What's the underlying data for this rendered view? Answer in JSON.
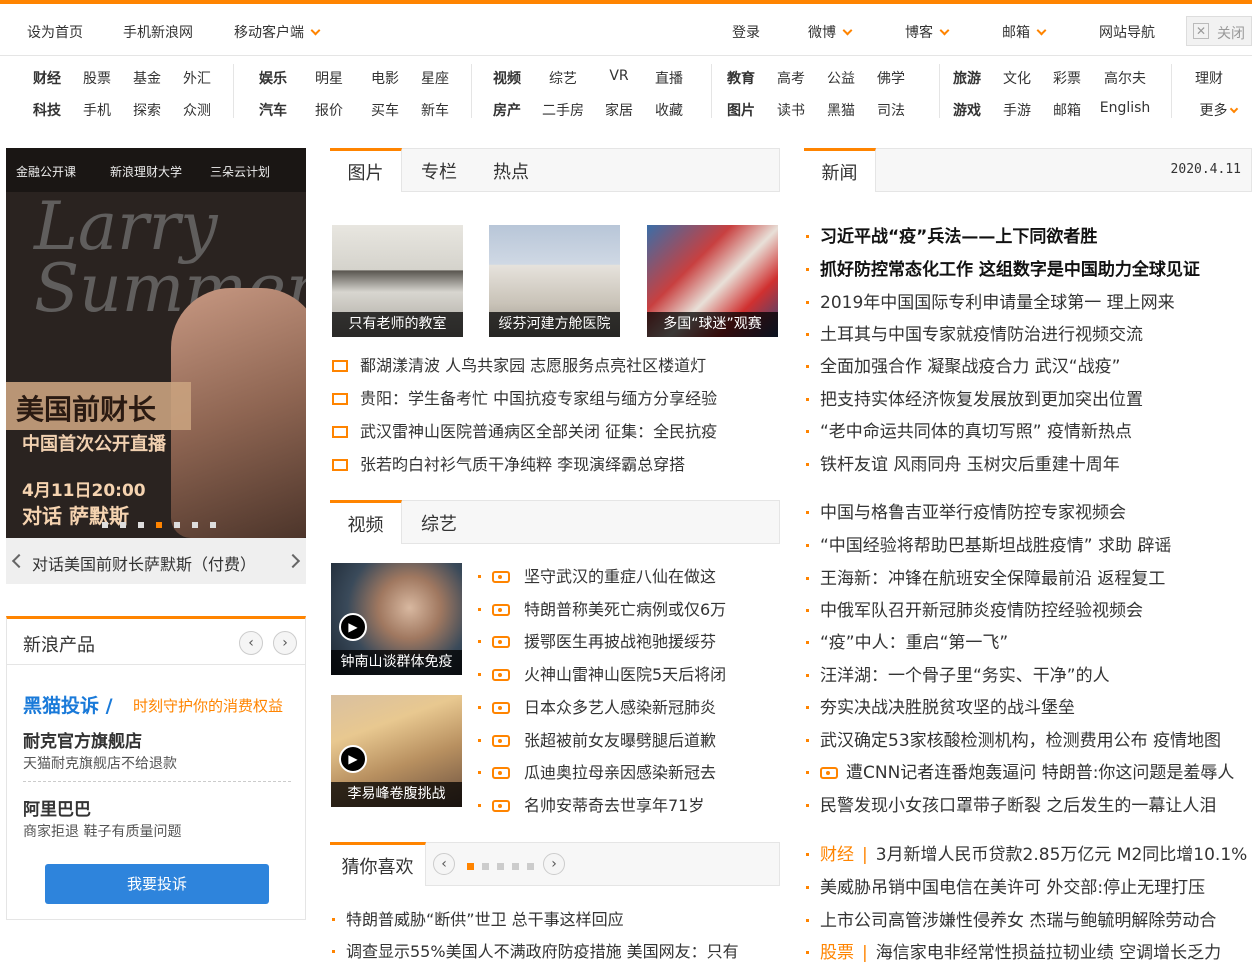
{
  "topbar": {
    "home": "设为首页",
    "mobile": "手机新浪网",
    "client": "移动客户端",
    "login": "登录",
    "weibo": "微博",
    "blog": "博客",
    "mail": "邮箱",
    "sitenav": "网站导航",
    "close": "关闭"
  },
  "nav": {
    "g1": [
      "财经",
      "股票",
      "基金",
      "外汇",
      "科技",
      "手机",
      "探索",
      "众测"
    ],
    "g2": [
      "娱乐",
      "明星",
      "电影",
      "星座",
      "汽车",
      "报价",
      "买车",
      "新车"
    ],
    "g3": [
      "视频",
      "综艺",
      "VR",
      "直播",
      "房产",
      "二手房",
      "家居",
      "收藏"
    ],
    "g4": [
      "教育",
      "高考",
      "公益",
      "佛学",
      "图片",
      "读书",
      "黑猫",
      "司法"
    ],
    "g5": [
      "旅游",
      "文化",
      "彩票",
      "高尔夫",
      "游戏",
      "手游",
      "邮箱",
      "English"
    ],
    "g6": [
      "理财",
      "更多"
    ]
  },
  "banner": {
    "logo1": "金融公开课",
    "logo2": "新浪理财大学",
    "logo3": "三朵云计划",
    "larry": "Larry",
    "summers": "Summers",
    "title1": "美国前财长",
    "title2": "中国首次公开直播",
    "date": "4月11日20:00",
    "dialog": "对话 萨默斯",
    "caption": "对话美国前财长萨默斯（付费）"
  },
  "products": {
    "title": "新浪产品",
    "heimao": "黑猫投诉",
    "slogan": "时刻守护你的消费权益",
    "items": [
      {
        "name": "耐克官方旗舰店",
        "desc": "天猫耐克旗舰店不给退款"
      },
      {
        "name": "阿里巴巴",
        "desc": "商家拒退 鞋子有质量问题"
      }
    ],
    "button": "我要投诉"
  },
  "pic": {
    "tabs": [
      "图片",
      "专栏",
      "热点"
    ],
    "thumbs": [
      "只有老师的教室",
      "绥芬河建方舱医院",
      "多国“球迷”观赛"
    ],
    "lines": [
      "鄱湖漾清波 人鸟共家园 志愿服务点亮社区楼道灯",
      "贵阳：学生备考忙 中国抗疫专家组与缅方分享经验",
      "武汉雷神山医院普通病区全部关闭 征集：全民抗疫",
      "张若昀白衬衫气质干净纯粹 李现演绎霸总穿搭"
    ]
  },
  "video": {
    "tabs": [
      "视频",
      "综艺"
    ],
    "thumbs": [
      "钟南山谈群体免疫",
      "李易峰卷腹挑战"
    ],
    "lines": [
      "坚守武汉的重症八仙在做这",
      "特朗普称美死亡病例或仅6万",
      "援鄂医生再披战袍驰援绥芬",
      "火神山雷神山医院5天后将闭",
      "日本众多艺人感染新冠肺炎",
      "张超被前女友曝劈腿后道歉",
      "瓜迪奥拉母亲因感染新冠去",
      "名帅安蒂奇去世享年71岁"
    ]
  },
  "guess": {
    "title": "猜你喜欢",
    "lines": [
      "特朗普威胁“断供”世卫 总干事这样回应",
      "调查显示55%美国人不满政府防疫措施 美国网友：只有"
    ]
  },
  "news": {
    "title": "新闻",
    "date": "2020.4.11",
    "lines": [
      {
        "t": "习近平战“疫”兵法——上下同欲者胜",
        "b": true
      },
      {
        "t": "抓好防控常态化工作 这组数字是中国助力全球见证",
        "b": true
      },
      {
        "t": "2019年中国国际专利申请量全球第一 理上网来"
      },
      {
        "t": "土耳其与中国专家就疫情防治进行视频交流"
      },
      {
        "t": "全面加强合作 凝聚战疫合力 武汉“战疫”"
      },
      {
        "t": "把支持实体经济恢复发展放到更加突出位置"
      },
      {
        "t": "“老中命运共同体的真切写照” 疫情新热点"
      },
      {
        "t": "铁杆友谊 风雨同舟 玉树灾后重建十周年"
      },
      {
        "t": "中国与格鲁吉亚举行疫情防控专家视频会"
      },
      {
        "t": "“中国经验将帮助巴基斯坦战胜疫情” 求助 辟谣"
      },
      {
        "t": "王海新：冲锋在航班安全保障最前沿 返程复工"
      },
      {
        "t": "中俄军队召开新冠肺炎疫情防控经验视频会"
      },
      {
        "t": "“疫”中人：重启“第一飞”"
      },
      {
        "t": "汪洋湖：一个骨子里“务实、干净”的人"
      },
      {
        "t": "夯实决战决胜脱贫攻坚的战斗堡垒"
      },
      {
        "t": "武汉确定53家核酸检测机构，检测费用公布 疫情地图"
      },
      {
        "t": "遭CNN记者连番炮轰逼问 特朗普:你这问题是羞辱人",
        "v": true
      },
      {
        "t": "民警发现小女孩口罩带子断裂 之后发生的一幕让人泪"
      },
      {
        "t": "3月新增人民币贷款2.85万亿元 M2同比增10.1%",
        "cat": "财经"
      },
      {
        "t": "美威胁吊销中国电信在美许可 外交部:停止无理打压"
      },
      {
        "t": "上市公司高管涉嫌性侵养女 杰瑞与鲍毓明解除劳动合"
      },
      {
        "t": "海信家电非经常性损益拉韧业绩 空调增长乏力",
        "cat": "股票"
      }
    ]
  }
}
